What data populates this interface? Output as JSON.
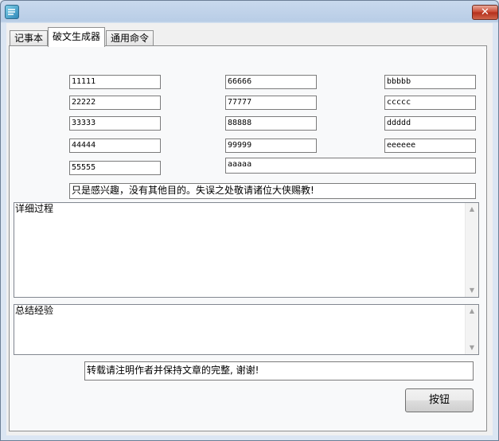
{
  "window": {
    "title": ""
  },
  "tabs": [
    {
      "label": "记事本"
    },
    {
      "label": "破文生成器"
    },
    {
      "label": "通用命令"
    }
  ],
  "fields": {
    "col1": [
      "11111",
      "22222",
      "33333",
      "44444",
      "55555"
    ],
    "col2": [
      "66666",
      "77777",
      "88888",
      "99999"
    ],
    "col3": [
      "bbbbb",
      "ccccc",
      "ddddd",
      "eeeeee"
    ],
    "wide": "aaaaa",
    "disclaimer": "只是感兴趣，没有其他目的。失误之处敬请诸位大侠赐教!",
    "detail": "详细过程",
    "summary": "总结经验",
    "footer": "转载请注明作者并保持文章的完整, 谢谢!"
  },
  "buttons": {
    "main": "按钮",
    "close": "✕"
  },
  "icons": {
    "app": "app-icon",
    "close": "close-icon",
    "scroll_up": "scroll-up-icon",
    "scroll_down": "scroll-down-icon"
  },
  "colors": {
    "titlebar": "#b8cde6",
    "close_button": "#c8442e",
    "panel": "#f8f9fa"
  }
}
